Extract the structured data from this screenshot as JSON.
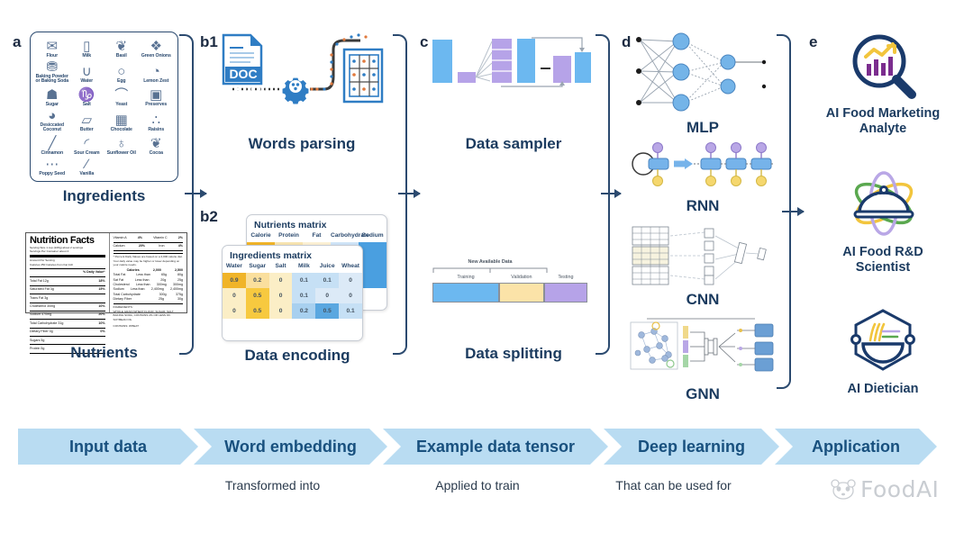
{
  "figure": {
    "panels": [
      "a",
      "b1",
      "b2",
      "c",
      "d",
      "e"
    ]
  },
  "panel_a": {
    "letter": "a",
    "ingredients_caption": "Ingredients",
    "nutrients_caption": "Nutrients",
    "ingredients": [
      {
        "name": "Flour",
        "icon": "flour-sack-icon",
        "glyph": "✉"
      },
      {
        "name": "Milk",
        "icon": "milk-carton-icon",
        "glyph": "▯"
      },
      {
        "name": "Basil",
        "icon": "basil-leaf-icon",
        "glyph": "❦"
      },
      {
        "name": "Green Onions",
        "icon": "green-onion-icon",
        "glyph": "❖"
      },
      {
        "name": "Baking Powder or Baking Soda",
        "icon": "baking-powder-icon",
        "glyph": "⛃"
      },
      {
        "name": "Water",
        "icon": "water-glass-icon",
        "glyph": "∪"
      },
      {
        "name": "Egg",
        "icon": "egg-icon",
        "glyph": "○"
      },
      {
        "name": "Lemon Zest",
        "icon": "lemon-zest-icon",
        "glyph": "◔"
      },
      {
        "name": "Sugar",
        "icon": "sugar-bowl-icon",
        "glyph": "☗"
      },
      {
        "name": "Salt",
        "icon": "salt-shaker-icon",
        "glyph": "♑"
      },
      {
        "name": "Yeast",
        "icon": "yeast-spoon-icon",
        "glyph": "⌒"
      },
      {
        "name": "Preserves",
        "icon": "preserves-jar-icon",
        "glyph": "▣"
      },
      {
        "name": "Desiccated Coconut",
        "icon": "coconut-icon",
        "glyph": "◕"
      },
      {
        "name": "Butter",
        "icon": "butter-icon",
        "glyph": "▱"
      },
      {
        "name": "Chocolate",
        "icon": "chocolate-bar-icon",
        "glyph": "▦"
      },
      {
        "name": "Raisins",
        "icon": "raisins-icon",
        "glyph": "∴"
      },
      {
        "name": "Cinnamon",
        "icon": "cinnamon-stick-icon",
        "glyph": "╱"
      },
      {
        "name": "Sour Cream",
        "icon": "sour-cream-icon",
        "glyph": "◜"
      },
      {
        "name": "Sunflower Oil",
        "icon": "oil-bottle-icon",
        "glyph": "♁"
      },
      {
        "name": "Cocoa",
        "icon": "cocoa-icon",
        "glyph": "❦"
      },
      {
        "name": "Poppy Seed",
        "icon": "poppy-seed-icon",
        "glyph": "⋯"
      },
      {
        "name": "Vanilla",
        "icon": "vanilla-pod-icon",
        "glyph": "∕"
      }
    ],
    "nutrition_label": {
      "title": "Nutrition Facts",
      "serving_info": "Serving Size  1 cup  (228g) about  2 servings",
      "servings_line": "Servings Per Container  about 2",
      "amount_header": "Amount Per Serving",
      "calories_line": "Calories  250          Calories from Fat  110",
      "dv_header": "% Daily Value*",
      "rows": [
        {
          "label": "Total Fat  12g",
          "value": "18%"
        },
        {
          "label": "Saturated Fat  3g",
          "value": "15%"
        },
        {
          "label": "Trans Fat  3g",
          "value": ""
        },
        {
          "label": "Cholesterol  30mg",
          "value": "10%"
        },
        {
          "label": "Sodium  470mg",
          "value": "20%"
        },
        {
          "label": "Total Carbohydrate  31g",
          "value": "10%"
        },
        {
          "label": "Dietary Fiber  0g",
          "value": "0%"
        },
        {
          "label": "Sugars  5g",
          "value": ""
        },
        {
          "label": "Protein  5g",
          "value": ""
        }
      ],
      "vitamins": [
        {
          "label": "Vitamin A",
          "value": "4%",
          "label2": "Vitamin C",
          "value2": "2%"
        },
        {
          "label": "Calcium",
          "value": "20%",
          "label2": "Iron",
          "value2": "4%"
        }
      ],
      "footnote": "* Percent Daily Values are based on a 2,000 calorie diet. Your daily value may be higher or lower depending on your calorie needs.",
      "table_header": [
        "",
        "Calories",
        "2,000",
        "2,500"
      ],
      "table_rows": [
        [
          "Total Fat",
          "Less than",
          "65g",
          "80g"
        ],
        [
          "Sat Fat",
          "Less than",
          "20g",
          "25g"
        ],
        [
          "Cholesterol",
          "Less than",
          "300mg",
          "300mg"
        ],
        [
          "Sodium",
          "Less than",
          "2,400mg",
          "2,400mg"
        ],
        [
          "Total Carbohydrate",
          "",
          "300g",
          "375g"
        ],
        [
          "Dietary Fiber",
          "",
          "25g",
          "30g"
        ]
      ],
      "ingredients_header": "INGREDIENTS:",
      "ingredients_text": "WHOLE GRAIN WHEAT FLOUR, SUGAR, SALT, BAKING SODA, CONTAINS 2% OR LESS OF: SOYBEAN OIL",
      "contains": "CONTAINS: WHEAT"
    }
  },
  "panel_b1": {
    "letter": "b1",
    "caption": "Words parsing",
    "doc_label": "DOC",
    "icons": [
      "document-icon",
      "gear-icon",
      "table-grid-icon"
    ]
  },
  "panel_b2": {
    "letter": "b2",
    "caption": "Data encoding",
    "nutrients_matrix": {
      "title": "Nutrients matrix",
      "columns": [
        "Calorie",
        "Protein",
        "Fat",
        "Carbohydrate",
        "Sodium"
      ]
    },
    "ingredients_matrix": {
      "title": "Ingredients matrix",
      "columns": [
        "Water",
        "Sugar",
        "Salt",
        "Milk",
        "Juice",
        "Wheat"
      ],
      "rows": [
        [
          "0.9",
          "0.2",
          "0",
          "0.1",
          "0.1",
          "0"
        ],
        [
          "0",
          "0.5",
          "0",
          "0.1",
          "0",
          "0"
        ],
        [
          "0",
          "0.5",
          "0",
          "0.2",
          "0.5",
          "0.1"
        ]
      ]
    }
  },
  "panel_c": {
    "letter": "c",
    "sampler_caption": "Data sampler",
    "splitting_caption": "Data splitting",
    "split": {
      "bracket_label": "New Available Data",
      "segments": [
        {
          "label": "Training",
          "color": "#6cb8f0",
          "fraction": 0.43
        },
        {
          "label": "Validation",
          "color": "#fbe3a8",
          "fraction": 0.29
        },
        {
          "label": "Testing",
          "color": "#b6a3e8",
          "fraction": 0.28
        }
      ]
    }
  },
  "panel_d": {
    "letter": "d",
    "models": [
      {
        "name": "MLP",
        "icon": "mlp-network-icon"
      },
      {
        "name": "RNN",
        "icon": "rnn-network-icon"
      },
      {
        "name": "CNN",
        "icon": "cnn-network-icon"
      },
      {
        "name": "GNN",
        "icon": "gnn-network-icon"
      }
    ]
  },
  "panel_e": {
    "letter": "e",
    "applications": [
      {
        "label": "AI Food Marketing\nAnalyte",
        "line1": "AI Food Marketing",
        "line2": "Analyte",
        "icon": "magnifier-chart-icon"
      },
      {
        "label": "AI Food R&D\nScientist",
        "line1": "AI Food R&D",
        "line2": "Scientist",
        "icon": "cloche-atom-icon"
      },
      {
        "label": "AI Dietician",
        "line1": "AI Dietician",
        "line2": "",
        "icon": "bowl-hexagon-icon"
      }
    ]
  },
  "pipeline": {
    "steps": [
      {
        "label": "Input data",
        "sublabel": ""
      },
      {
        "label": "Word embedding",
        "sublabel": "Transformed into"
      },
      {
        "label": "Example data tensor",
        "sublabel": "Applied to train"
      },
      {
        "label": "Deep learning",
        "sublabel": "That can be used for"
      },
      {
        "label": "Application",
        "sublabel": ""
      }
    ],
    "connectors": [
      "Transformed into",
      "Applied to train",
      "That can be used for"
    ]
  },
  "watermark": {
    "text": "FoodAI",
    "icon": "panda-face-icon"
  },
  "colors": {
    "chevron_bg": "#b9dcf2",
    "chevron_text": "#18507e",
    "blue_bar": "#6cb8f0",
    "purple_bar": "#b6a3e8",
    "yellow_cell": "#f0b429",
    "bracket": "#2b4a6f"
  }
}
